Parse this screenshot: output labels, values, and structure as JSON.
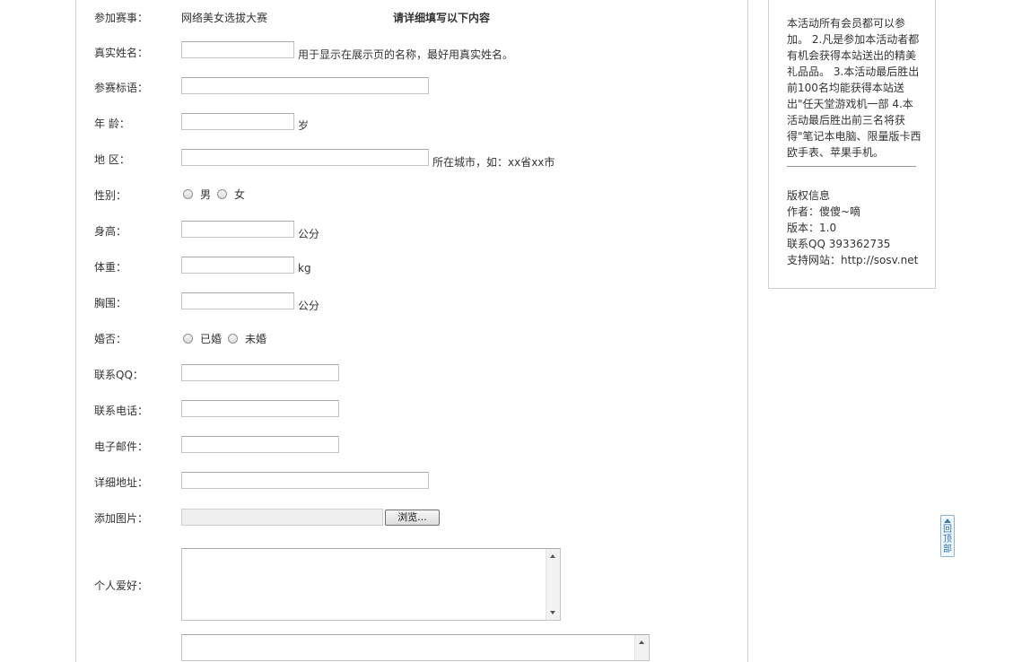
{
  "form": {
    "title": "请详细填写以下内容",
    "contest": {
      "label": "参加赛事：",
      "value": "网络美女选拔大赛"
    },
    "real_name": {
      "label": "真实姓名：",
      "value": "",
      "hint": "用于显示在展示页的名称，最好用真实姓名。"
    },
    "slogan": {
      "label": "参赛标语：",
      "value": ""
    },
    "age": {
      "label": "年 龄：",
      "value": "",
      "unit": "岁"
    },
    "region": {
      "label": "地 区：",
      "value": "",
      "hint": "所在城市，如：xx省xx市"
    },
    "gender": {
      "label": "性别：",
      "options": [
        "男",
        "女"
      ]
    },
    "height": {
      "label": "身高：",
      "value": "",
      "unit": "公分"
    },
    "weight": {
      "label": "体重：",
      "value": "",
      "unit": "kg"
    },
    "bust": {
      "label": "胸围：",
      "value": "",
      "unit": "公分"
    },
    "marital": {
      "label": "婚否：",
      "options": [
        "已婚",
        "未婚"
      ]
    },
    "qq": {
      "label": "联系QQ：",
      "value": ""
    },
    "phone": {
      "label": "联系电话：",
      "value": ""
    },
    "email": {
      "label": "电子邮件：",
      "value": ""
    },
    "address": {
      "label": "详细地址：",
      "value": ""
    },
    "photo": {
      "label": "添加图片：",
      "browse_label": "浏览..."
    },
    "hobbies": {
      "label": "个人爱好：",
      "value": ""
    }
  },
  "sidebar": {
    "notice": "本活动所有会员都可以参加。 2.凡是参加本活动者都有机会获得本站送出的精美礼品品。 3.本活动最后胜出前100名均能获得本站送出\"任天堂游戏机一部 4.本活动最后胜出前三名将获得\"笔记本电脑、限量版卡西欧手表、苹果手机。",
    "copyright": {
      "title": "版权信息",
      "author": "作者：傻傻~嘀",
      "version": "版本：1.0",
      "qq": "联系QQ 393362735",
      "website": "支持网站：http://sosv.net"
    }
  },
  "back_to_top": {
    "label": "回顶部"
  }
}
